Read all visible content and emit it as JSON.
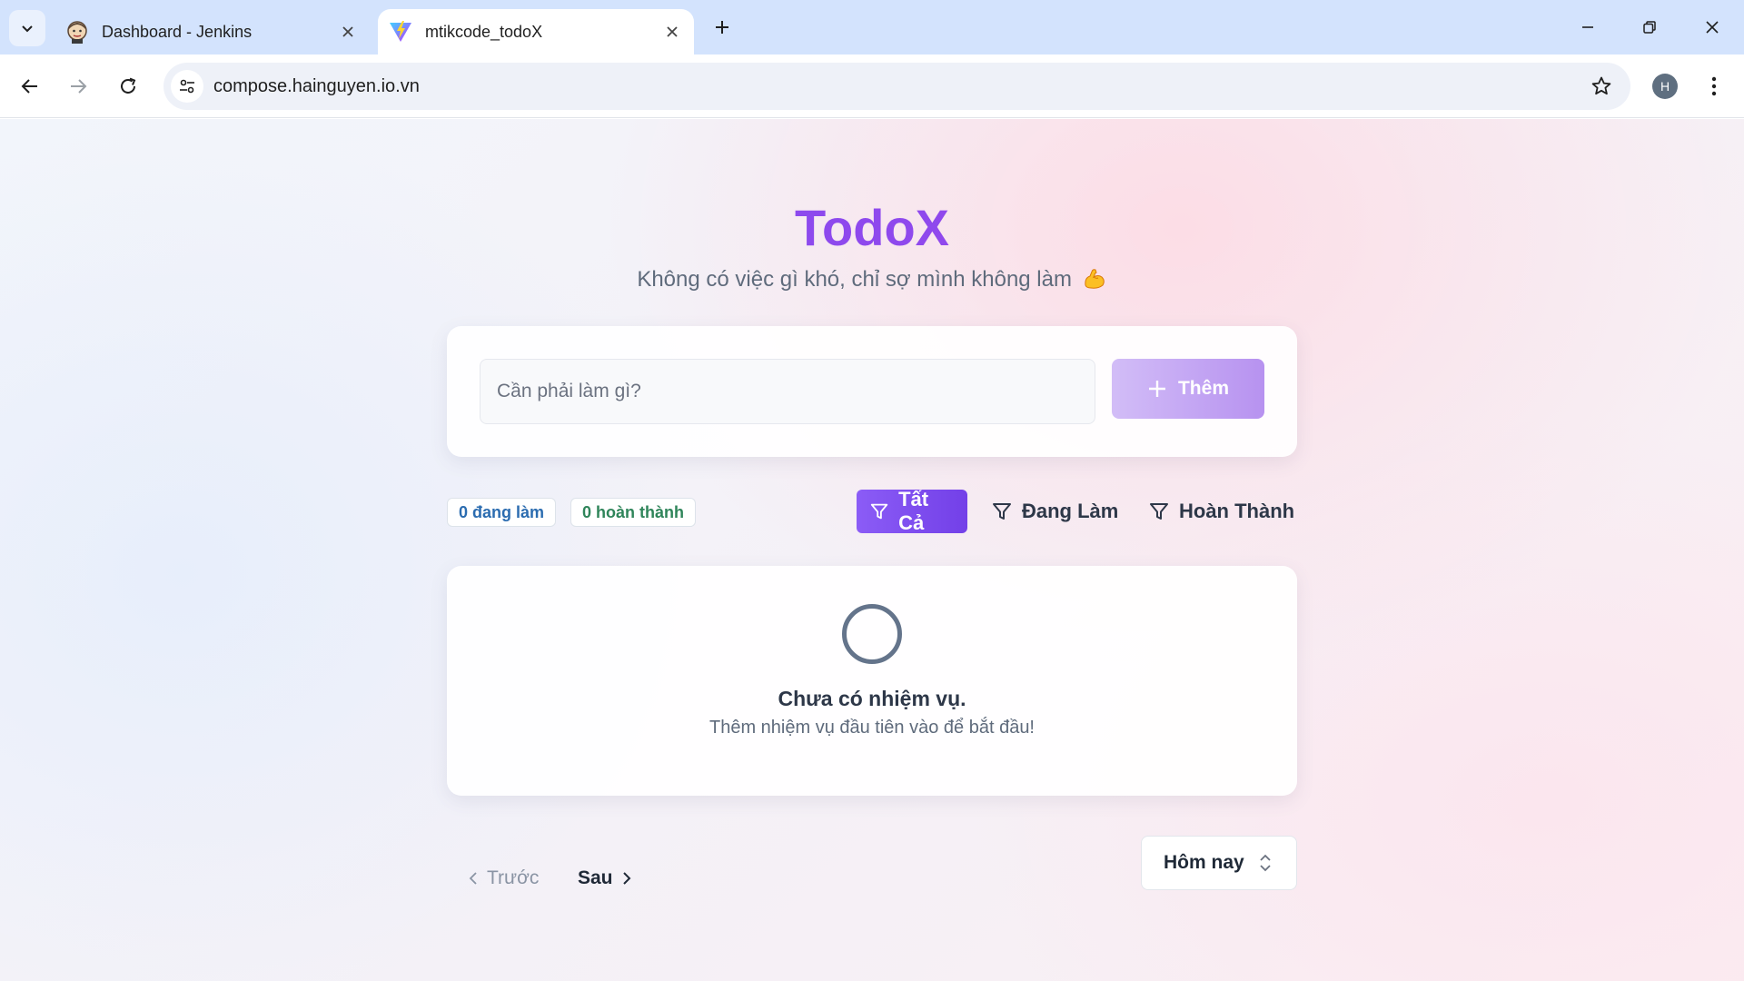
{
  "browser": {
    "tabs": [
      {
        "title": "Dashboard - Jenkins",
        "favicon": "jenkins-icon",
        "active": false
      },
      {
        "title": "mtikcode_todoX",
        "favicon": "vite-icon",
        "active": true
      }
    ],
    "url": "compose.hainguyen.io.vn",
    "profile_initial": "H"
  },
  "app": {
    "title": "TodoX",
    "subtitle": "Không có việc gì khó, chỉ sợ mình không làm",
    "subtitle_emoji": "flexed-biceps-emoji"
  },
  "add_form": {
    "placeholder": "Cần phải làm gì?",
    "button_label": "Thêm"
  },
  "stats": {
    "active": "0 đang làm",
    "done": "0 hoàn thành"
  },
  "filters": {
    "all": "Tất Cả",
    "active": "Đang Làm",
    "done": "Hoàn Thành",
    "selected": "all"
  },
  "empty_state": {
    "title": "Chưa có nhiệm vụ.",
    "description": "Thêm nhiệm vụ đầu tiên vào để bắt đầu!"
  },
  "pagination": {
    "prev": "Trước",
    "next": "Sau"
  },
  "date_filter": {
    "value": "Hôm nay"
  },
  "colors": {
    "accent": "#8b5cf6",
    "title_gradient_start": "#7c4ef2",
    "title_gradient_end": "#a044e8",
    "active_badge": "#2b6cb0",
    "done_badge": "#2f855a"
  }
}
